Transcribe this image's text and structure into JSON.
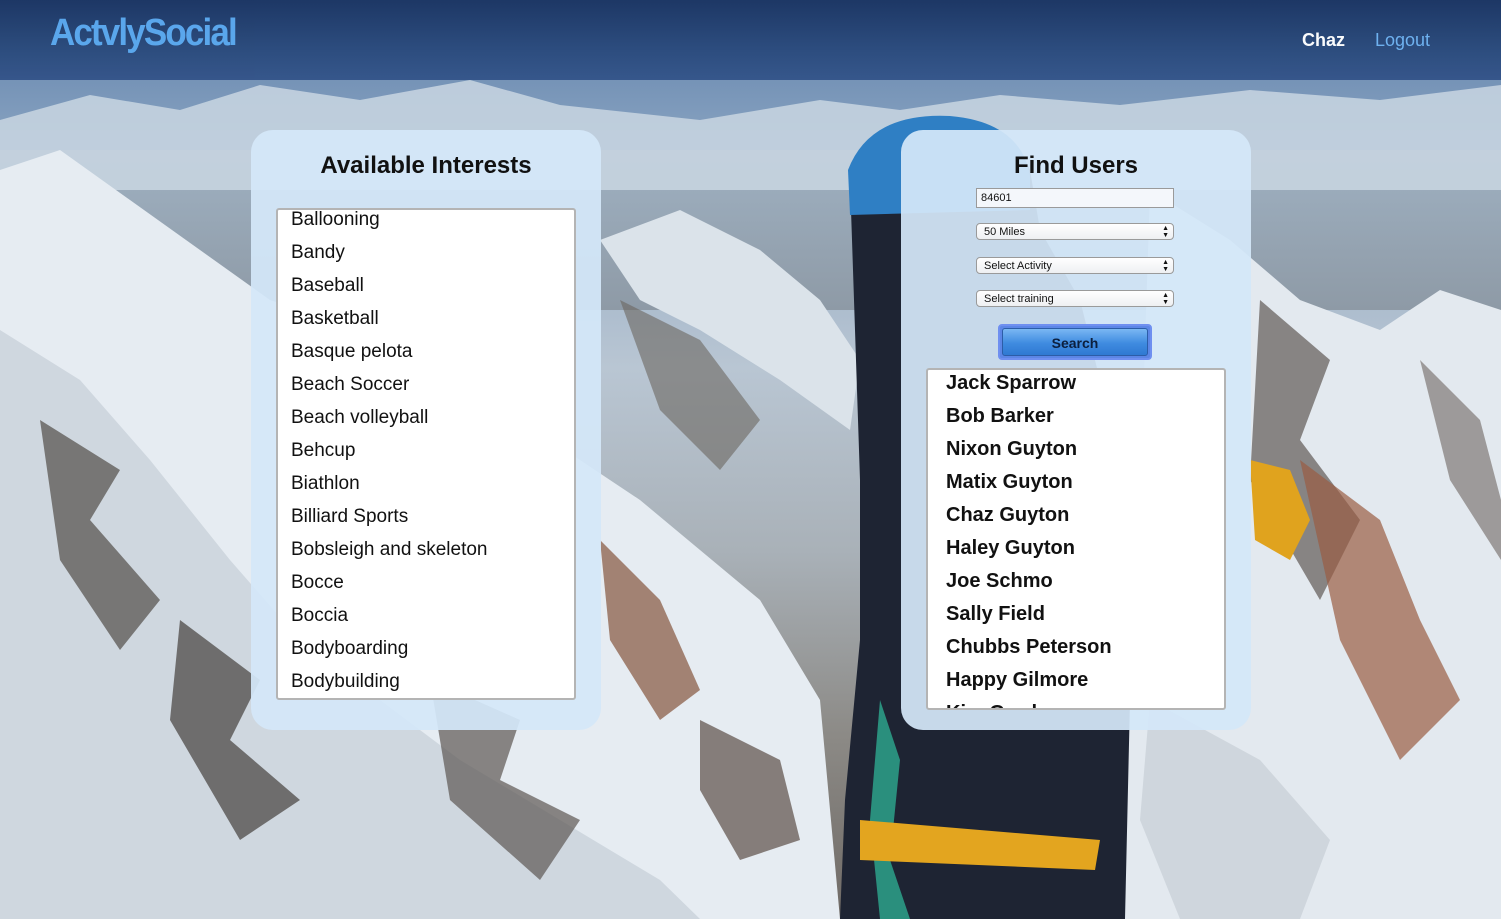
{
  "brand": "ActvlySocial",
  "nav": {
    "user": "Chaz",
    "logout": "Logout"
  },
  "interests": {
    "title": "Available Interests",
    "items": [
      "Ballooning",
      "Bandy",
      "Baseball",
      "Basketball",
      "Basque pelota",
      "Beach Soccer",
      "Beach volleyball",
      "Behcup",
      "Biathlon",
      "Billiard Sports",
      "Bobsleigh and skeleton",
      "Bocce",
      "Boccia",
      "Bodyboarding",
      "Bodybuilding"
    ]
  },
  "find_users": {
    "title": "Find Users",
    "zip_value": "84601",
    "distance_selected": "50 Miles",
    "activity_selected": "Select Activity",
    "training_selected": "Select training",
    "search_label": "Search",
    "results": [
      "Jack Sparrow",
      "Bob Barker",
      "Nixon Guyton",
      "Matix Guyton",
      "Chaz Guyton",
      "Haley Guyton",
      "Joe Schmo",
      "Sally Field",
      "Chubbs Peterson",
      "Happy Gilmore",
      "Kim Gordon"
    ]
  },
  "icons": {
    "select_chevron": "chevron-updown-icon"
  },
  "colors": {
    "brand": "#5aa8ee",
    "navbar": "#1b3563",
    "logout": "#6fb3f2",
    "card": "#d4e7f9",
    "button": "#3f8be0"
  }
}
